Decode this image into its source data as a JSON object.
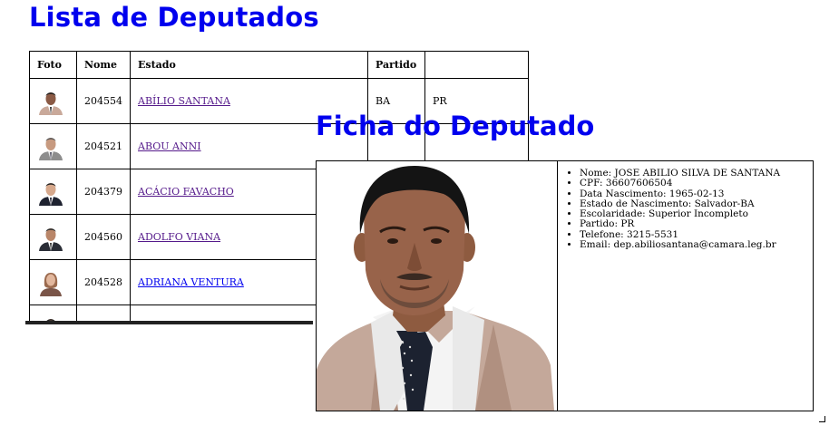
{
  "lista": {
    "title": "Lista de Deputados",
    "columns": [
      "Foto",
      "Nome",
      "Estado",
      "Partido",
      ""
    ],
    "rows": [
      {
        "id": "204554",
        "name": "ABÍLIO SANTANA",
        "estado": "BA",
        "partido": "PR",
        "visited": true
      },
      {
        "id": "204521",
        "name": "ABOU ANNI",
        "estado": "",
        "partido": "",
        "visited": true
      },
      {
        "id": "204379",
        "name": "ACÁCIO FAVACHO",
        "estado": "",
        "partido": "",
        "visited": true
      },
      {
        "id": "204560",
        "name": "ADOLFO VIANA",
        "estado": "",
        "partido": "",
        "visited": true
      },
      {
        "id": "204528",
        "name": "ADRIANA VENTURA",
        "estado": "",
        "partido": "",
        "visited": false
      }
    ]
  },
  "ficha": {
    "title": "Ficha do Deputado",
    "details": [
      "Nome: JOSE ABILIO SILVA DE SANTANA",
      "CPF: 36607606504",
      "Data Nascimento: 1965-02-13",
      "Estado de Nascimento: Salvador-BA",
      "Escolaridade: Superior Incompleto",
      "Partido: PR",
      "Telefone: 3215-5531",
      "Email: dep.abiliosantana@camara.leg.br"
    ]
  },
  "colors": {
    "heading": "#0000ee",
    "link": "#0000ee",
    "visited_link": "#551a8b"
  }
}
